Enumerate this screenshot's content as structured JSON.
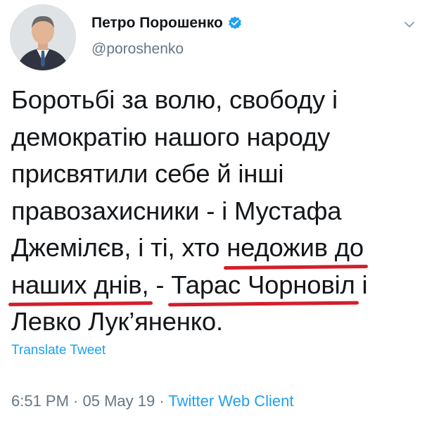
{
  "author": {
    "display_name": "Петро Порошенко",
    "handle": "@poroshenko",
    "verified": true,
    "avatar_icon": "profile-photo"
  },
  "tweet": {
    "lines": [
      [
        {
          "text": "Боротьбі за волю, свободу і"
        }
      ],
      [
        {
          "text": "демократію нашого народу"
        }
      ],
      [
        {
          "text": "присвятили себе й інші"
        }
      ],
      [
        {
          "text": "правозахисники - і Мустафа"
        }
      ],
      [
        {
          "text": "Джемілєв, і ті, хто "
        },
        {
          "text": "недожив до",
          "underlined": true
        }
      ],
      [
        {
          "text": "наших днів,",
          "underlined": true
        },
        {
          "text": " - "
        },
        {
          "text": "Тарас Чорновіл",
          "underlined": true
        },
        {
          "text": " і"
        }
      ],
      [
        {
          "text": "Левко Лук’яненко."
        }
      ]
    ],
    "underline_color": "#d21f2a"
  },
  "translate_label": "Translate Tweet",
  "meta": {
    "time": "6:51 PM",
    "separator": " · ",
    "date": "05 May 19",
    "client": "Twitter Web Client"
  },
  "icons": {
    "verified": "verified-badge-icon",
    "menu": "chevron-down-icon"
  },
  "colors": {
    "link_blue": "#1da1f2",
    "muted_gray": "#657786",
    "text": "#14171a"
  }
}
